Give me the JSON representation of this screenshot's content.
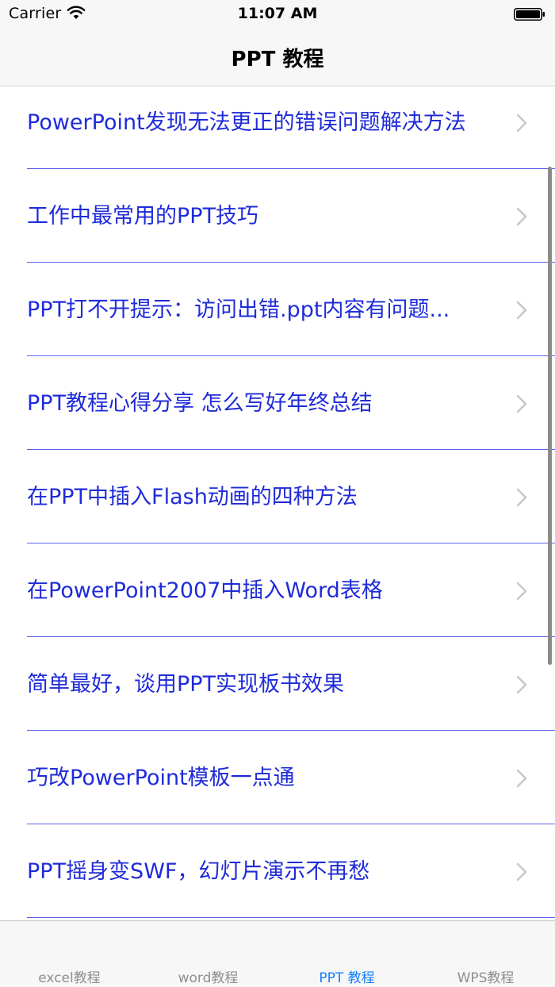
{
  "status_bar": {
    "carrier": "Carrier",
    "time": "11:07 AM",
    "wifi_icon": "wifi-icon",
    "battery_icon": "battery-icon"
  },
  "nav": {
    "title": "PPT 教程"
  },
  "list": {
    "items": [
      {
        "label": "PowerPoint发现无法更正的错误问题解决方法"
      },
      {
        "label": "工作中最常用的PPT技巧"
      },
      {
        "label": "PPT打不开提示：访问出错.ppt内容有问题..."
      },
      {
        "label": "PPT教程心得分享 怎么写好年终总结"
      },
      {
        "label": "在PPT中插入Flash动画的四种方法"
      },
      {
        "label": "在PowerPoint2007中插入Word表格"
      },
      {
        "label": "简单最好，谈用PPT实现板书效果"
      },
      {
        "label": "巧改PowerPoint模板一点通"
      },
      {
        "label": "PPT摇身变SWF，幻灯片演示不再愁"
      }
    ],
    "chevron_icon": "chevron-right-icon"
  },
  "tabbar": {
    "tabs": [
      {
        "label": "excel教程",
        "selected": false
      },
      {
        "label": "word教程",
        "selected": false
      },
      {
        "label": "PPT 教程",
        "selected": true
      },
      {
        "label": "WPS教程",
        "selected": false
      }
    ]
  },
  "colors": {
    "link_text": "#1f2bd8",
    "separator": "#5b62e8",
    "tab_selected": "#157efb",
    "tab_unselected": "#8e8e93",
    "bar_background": "#f7f7f8"
  }
}
